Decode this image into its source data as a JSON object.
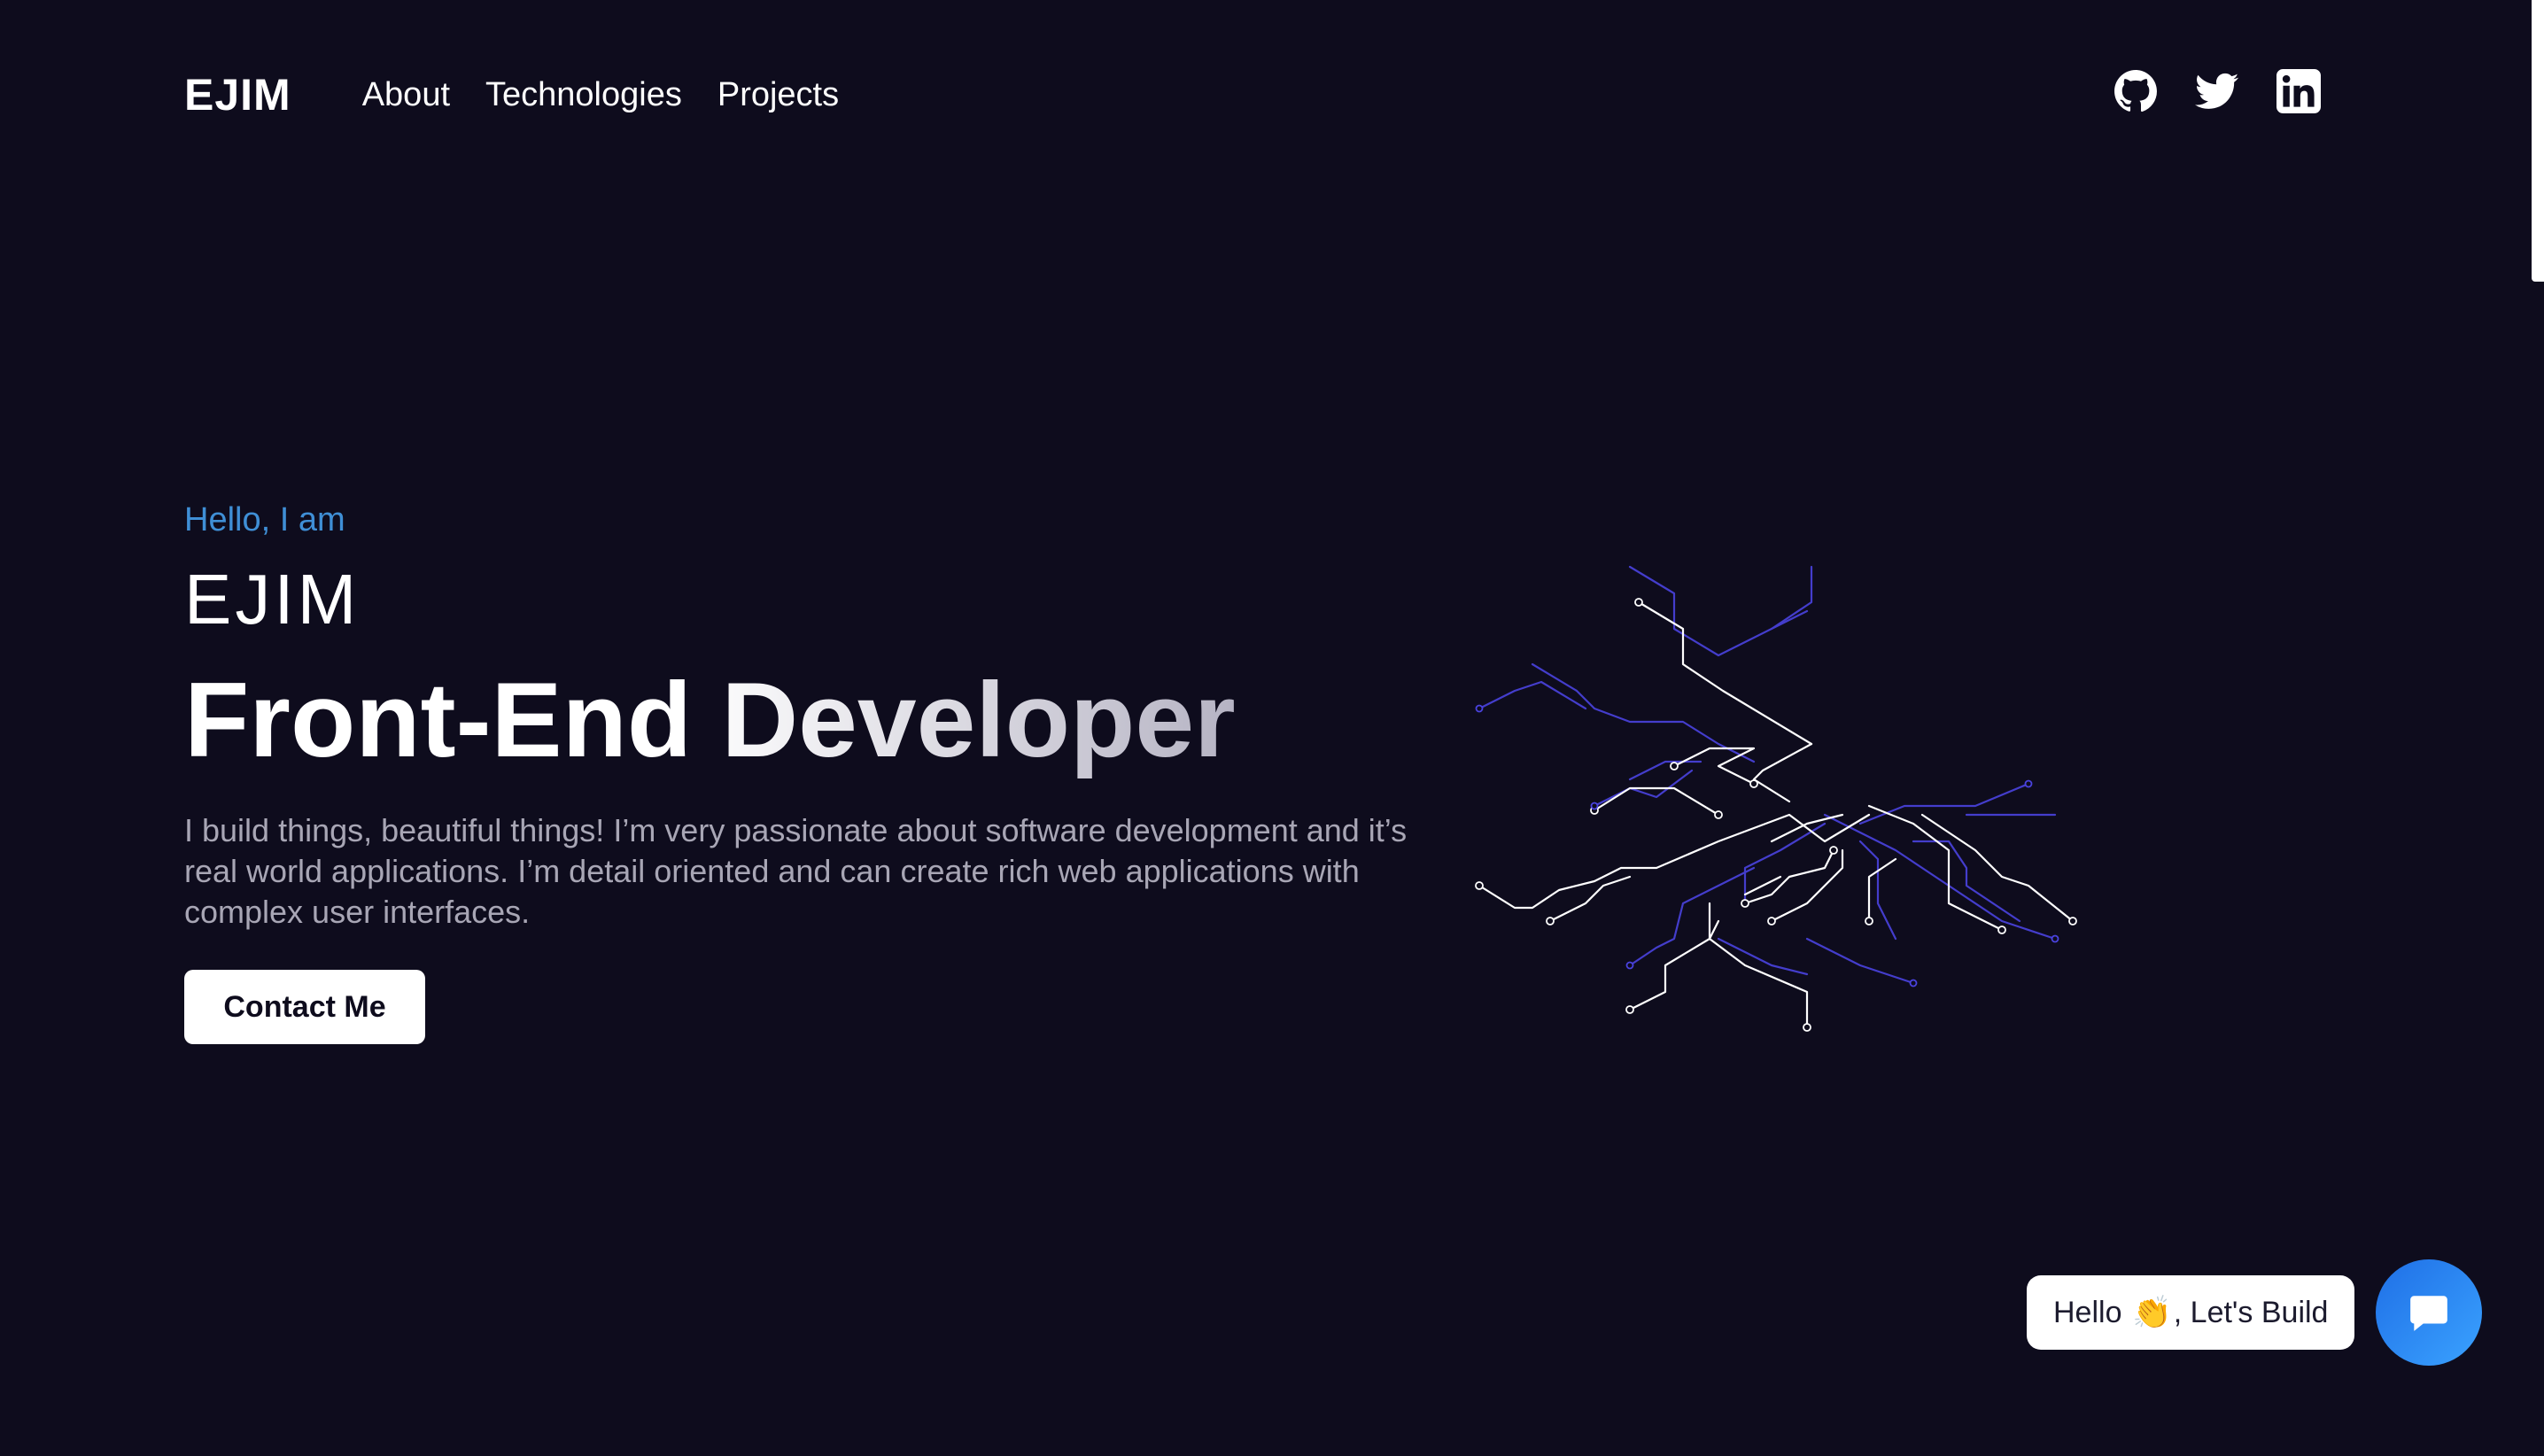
{
  "nav": {
    "logo": "EJIM",
    "links": [
      "About",
      "Technologies",
      "Projects"
    ],
    "socials": [
      "github-icon",
      "twitter-icon",
      "linkedin-icon"
    ]
  },
  "hero": {
    "greeting": "Hello, I am",
    "name": "EJIM",
    "role": "Front-End Developer",
    "description": "I build things, beautiful things! I’m very passionate about software development and it’s real world applications. I’m detail oriented and can create rich web applications with complex user interfaces.",
    "cta": "Contact Me"
  },
  "chat": {
    "greeting_before": "Hello ",
    "wave_icon": "👏",
    "greeting_after": ", Let's Build",
    "fab_icon": "chat-icon"
  },
  "colors": {
    "background": "#0e0c1d",
    "accent": "#3f8fd6",
    "fab": "#2a86f2"
  }
}
